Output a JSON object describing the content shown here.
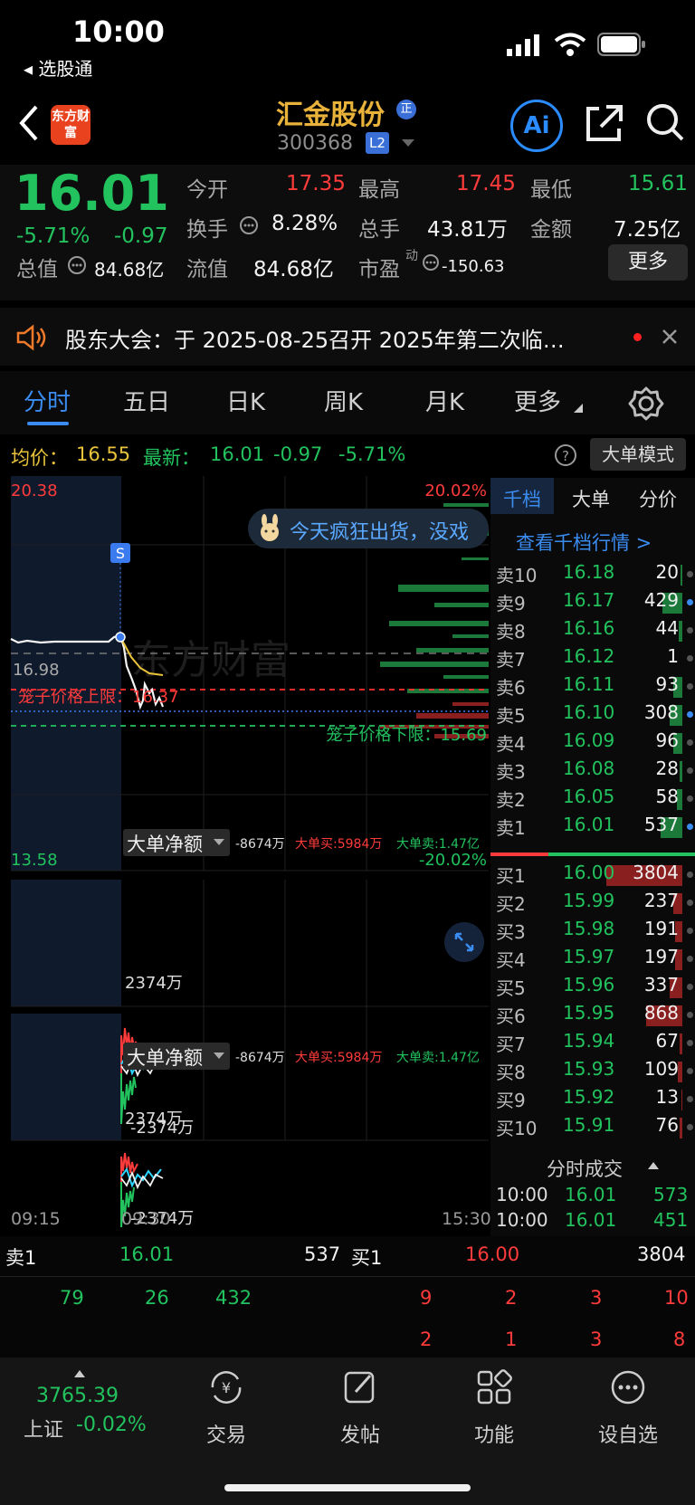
{
  "status_bar": {
    "time": "10:00",
    "back_app": "◂ 选股通"
  },
  "header": {
    "logo_text": "东方财富",
    "stock_name": "汇金股份",
    "name_badge": "正",
    "stock_code": "300368",
    "level_badge": "L2",
    "ai_label": "Ai"
  },
  "quote": {
    "price": "16.01",
    "change_pct": "-5.71%",
    "change": "-0.97",
    "open_label": "今开",
    "open": "17.35",
    "high_label": "最高",
    "high": "17.45",
    "low_label": "最低",
    "low": "15.61",
    "turnover_label": "换手",
    "turnover": "8.28%",
    "volume_label": "总手",
    "volume": "43.81万",
    "amount_label": "金额",
    "amount": "7.25亿",
    "mcap_label": "总值",
    "mcap": "84.68亿",
    "float_label": "流值",
    "float_cap": "84.68亿",
    "pe_label": "市盈",
    "pe_sup": "动",
    "pe": "-150.63",
    "more_button": "更多"
  },
  "notice": {
    "text": "股东大会：于 2025-08-25召开 2025年第二次临…"
  },
  "tabs": [
    "分时",
    "五日",
    "日K",
    "周K",
    "月K",
    "更多"
  ],
  "info_line": {
    "avg_label": "均价：",
    "avg": "16.55",
    "latest_label": "最新：",
    "latest": "16.01",
    "change": "-0.97",
    "change_pct": "-5.71%",
    "mode_button": "大单模式"
  },
  "chart": {
    "y_max": "20.38",
    "y_min": "13.58",
    "pct_max": "20.02%",
    "pct_min": "-20.02%",
    "ref_price": "16.98",
    "upper_limit_label": "笼子价格上限：16.37",
    "lower_limit_label": "笼子价格下限：15.69",
    "bubble_text": "今天疯狂出货，没戏",
    "watermark": "东方财富",
    "marker": "S",
    "time_start": "09:15",
    "time_mid": "09:30",
    "time_end": "15:30"
  },
  "flow_panels": [
    {
      "title": "大单净额",
      "net": "-8674万",
      "buy": "大单买:5984万",
      "sell": "大单卖:1.47亿",
      "top": "2374万",
      "bottom": "-2374万"
    },
    {
      "title": "大单净额",
      "net": "-8674万",
      "buy": "大单买:5984万",
      "sell": "大单卖:1.47亿",
      "top": "2374万",
      "bottom": "-2374万"
    }
  ],
  "book": {
    "tabs": [
      "千档",
      "大单",
      "分价"
    ],
    "link": "查看千档行情 >",
    "asks": [
      {
        "label": "卖10",
        "price": "16.18",
        "vol": "20"
      },
      {
        "label": "卖9",
        "price": "16.17",
        "vol": "429"
      },
      {
        "label": "卖8",
        "price": "16.16",
        "vol": "44"
      },
      {
        "label": "卖7",
        "price": "16.12",
        "vol": "1"
      },
      {
        "label": "卖6",
        "price": "16.11",
        "vol": "93"
      },
      {
        "label": "卖5",
        "price": "16.10",
        "vol": "308"
      },
      {
        "label": "卖4",
        "price": "16.09",
        "vol": "96"
      },
      {
        "label": "卖3",
        "price": "16.08",
        "vol": "28"
      },
      {
        "label": "卖2",
        "price": "16.05",
        "vol": "58"
      },
      {
        "label": "卖1",
        "price": "16.01",
        "vol": "537"
      }
    ],
    "bids": [
      {
        "label": "买1",
        "price": "16.00",
        "vol": "3804"
      },
      {
        "label": "买2",
        "price": "15.99",
        "vol": "237"
      },
      {
        "label": "买3",
        "price": "15.98",
        "vol": "191"
      },
      {
        "label": "买4",
        "price": "15.97",
        "vol": "197"
      },
      {
        "label": "买5",
        "price": "15.96",
        "vol": "337"
      },
      {
        "label": "买6",
        "price": "15.95",
        "vol": "868"
      },
      {
        "label": "买7",
        "price": "15.94",
        "vol": "67"
      },
      {
        "label": "买8",
        "price": "15.93",
        "vol": "109"
      },
      {
        "label": "买9",
        "price": "15.92",
        "vol": "13"
      },
      {
        "label": "买10",
        "price": "15.91",
        "vol": "76"
      }
    ],
    "ticks_title": "分时成交",
    "ticks": [
      {
        "time": "10:00",
        "price": "16.01",
        "vol": "573"
      },
      {
        "time": "10:00",
        "price": "16.01",
        "vol": "451"
      }
    ]
  },
  "summary": {
    "ask_label": "卖1",
    "ask_price": "16.01",
    "ask_vol": "537",
    "bid_label": "买1",
    "bid_price": "16.00",
    "bid_vol": "3804",
    "ask_queue": [
      "79",
      "26",
      "432"
    ],
    "bid_queue_1": [
      "9",
      "2",
      "3",
      "10"
    ],
    "bid_queue_2": [
      "2",
      "1",
      "3",
      "8"
    ]
  },
  "bottom_nav": {
    "index_value": "3765.39",
    "index_name": "上证",
    "index_change": "-0.02%",
    "items": [
      "交易",
      "发帖",
      "功能",
      "设自选"
    ]
  },
  "colors": {
    "up": "#ff3b3b",
    "down": "#22c35e",
    "accent": "#2a8cff",
    "gold": "#e9b23a"
  }
}
